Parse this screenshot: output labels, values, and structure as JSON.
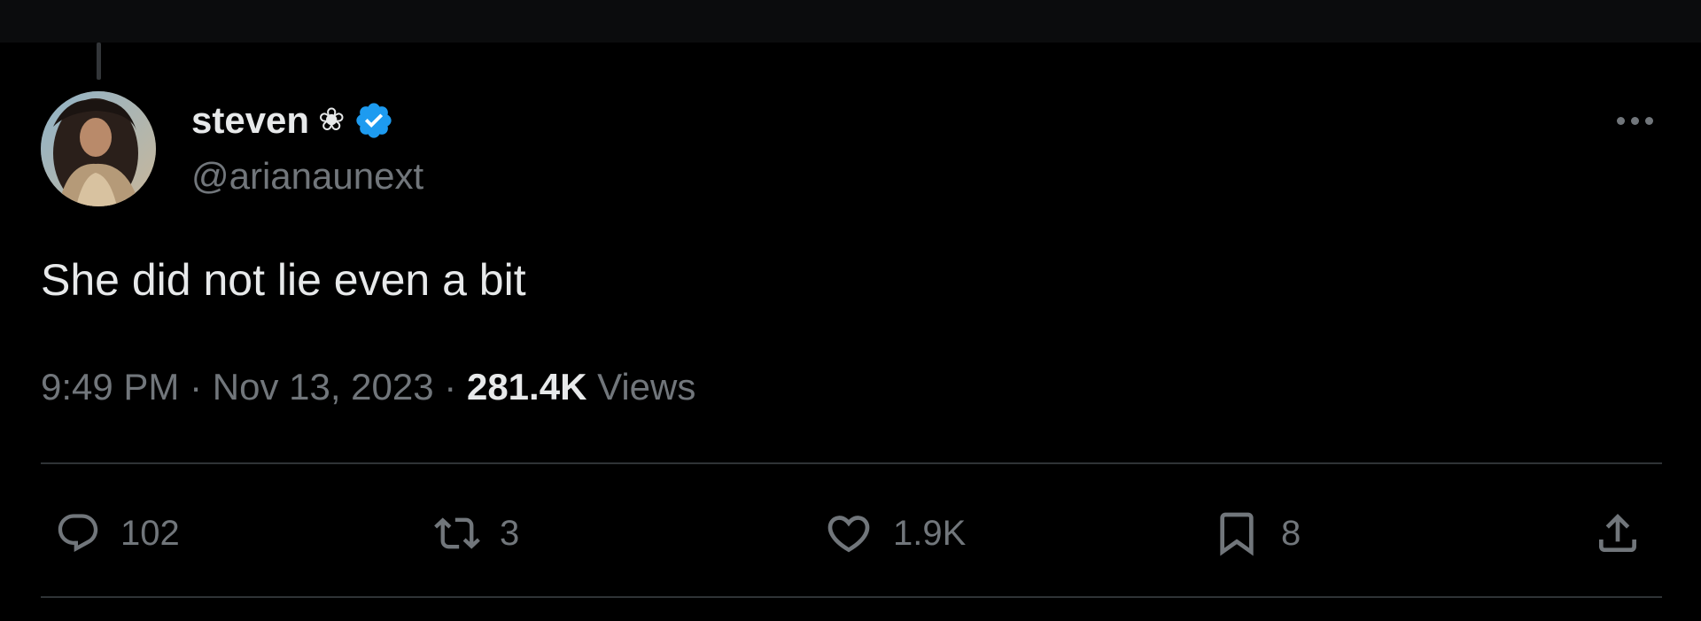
{
  "author": {
    "display_name": "steven",
    "name_emoji": "❀",
    "verified": true,
    "handle": "@arianaunext"
  },
  "tweet": {
    "text": "She did not lie even a bit",
    "time": "9:49 PM",
    "separator_1": "·",
    "date": "Nov 13, 2023",
    "separator_2": "·",
    "views_count": "281.4K",
    "views_label": "Views"
  },
  "actions": {
    "reply_count": "102",
    "retweet_count": "3",
    "like_count": "1.9K",
    "bookmark_count": "8"
  },
  "icons": {
    "more": "more-horizontal-icon",
    "reply": "reply-icon",
    "retweet": "retweet-icon",
    "like": "heart-icon",
    "bookmark": "bookmark-icon",
    "share": "share-icon",
    "verified": "verified-badge-icon"
  },
  "colors": {
    "background": "#000000",
    "primary_text": "#e7e9ea",
    "secondary_text": "#71767b",
    "divider": "#2f3336",
    "verified_blue": "#1d9bf0"
  }
}
